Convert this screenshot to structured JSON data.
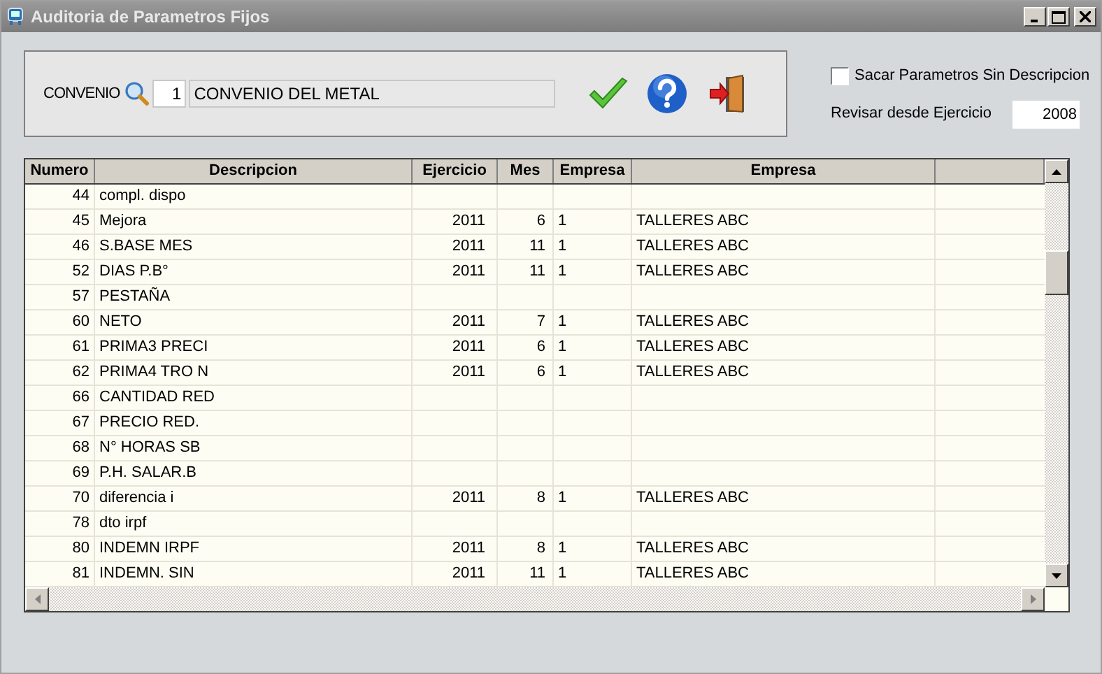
{
  "window": {
    "title": "Auditoria de Parametros Fijos"
  },
  "convenio": {
    "label": "CONVENIO",
    "code": "1",
    "name": "CONVENIO DEL METAL"
  },
  "options": {
    "checkbox": {
      "label": "Sacar Parametros Sin Descripcion",
      "checked": false
    },
    "ejercicio_label": "Revisar desde Ejercicio",
    "ejercicio_value": "2008"
  },
  "table": {
    "columns": [
      "Numero",
      "Descripcion",
      "Ejercicio",
      "Mes",
      "Empresa",
      "Empresa"
    ],
    "rows": [
      {
        "numero": "44",
        "descripcion": "compl. dispo"
      },
      {
        "numero": "45",
        "descripcion": "Mejora",
        "ejercicio": "2011",
        "mes": "6",
        "empresa": "1",
        "empresa_nombre": "TALLERES ABC"
      },
      {
        "numero": "46",
        "descripcion": "S.BASE MES",
        "ejercicio": "2011",
        "mes": "11",
        "empresa": "1",
        "empresa_nombre": "TALLERES ABC"
      },
      {
        "numero": "52",
        "descripcion": "DIAS P.B°",
        "ejercicio": "2011",
        "mes": "11",
        "empresa": "1",
        "empresa_nombre": "TALLERES ABC"
      },
      {
        "numero": "57",
        "descripcion": "PESTAÑA"
      },
      {
        "numero": "60",
        "descripcion": "NETO",
        "ejercicio": "2011",
        "mes": "7",
        "empresa": "1",
        "empresa_nombre": "TALLERES ABC"
      },
      {
        "numero": "61",
        "descripcion": "PRIMA3 PRECI",
        "ejercicio": "2011",
        "mes": "6",
        "empresa": "1",
        "empresa_nombre": "TALLERES ABC"
      },
      {
        "numero": "62",
        "descripcion": "PRIMA4 TRO N",
        "ejercicio": "2011",
        "mes": "6",
        "empresa": "1",
        "empresa_nombre": "TALLERES ABC"
      },
      {
        "numero": "66",
        "descripcion": "CANTIDAD RED"
      },
      {
        "numero": "67",
        "descripcion": "PRECIO  RED."
      },
      {
        "numero": "68",
        "descripcion": "N° HORAS SB"
      },
      {
        "numero": "69",
        "descripcion": "P.H. SALAR.B"
      },
      {
        "numero": "70",
        "descripcion": "diferencia i",
        "ejercicio": "2011",
        "mes": "8",
        "empresa": "1",
        "empresa_nombre": "TALLERES ABC"
      },
      {
        "numero": "78",
        "descripcion": "dto irpf"
      },
      {
        "numero": "80",
        "descripcion": "INDEMN IRPF",
        "ejercicio": "2011",
        "mes": "8",
        "empresa": "1",
        "empresa_nombre": "TALLERES ABC"
      },
      {
        "numero": "81",
        "descripcion": "INDEMN. SIN",
        "ejercicio": "2011",
        "mes": "11",
        "empresa": "1",
        "empresa_nombre": "TALLERES ABC"
      }
    ]
  }
}
